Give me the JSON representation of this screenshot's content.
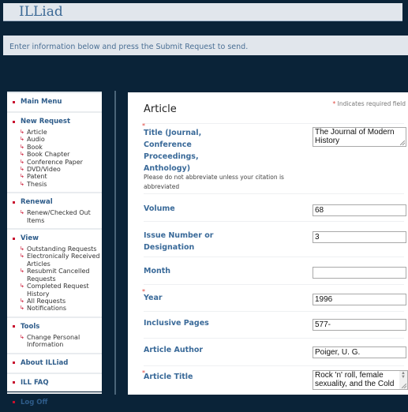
{
  "app": {
    "title": "ILLiad"
  },
  "notice": "Enter information below and press the Submit Request to send.",
  "sidebar": {
    "sections": [
      {
        "label": "Main Menu",
        "items": []
      },
      {
        "label": "New Request",
        "items": [
          "Article",
          "Audio",
          "Book",
          "Book Chapter",
          "Conference Paper",
          "DVD/Video",
          "Patent",
          "Thesis"
        ]
      },
      {
        "label": "Renewal",
        "items": [
          "Renew/Checked Out Items"
        ]
      },
      {
        "label": "View",
        "items": [
          "Outstanding Requests",
          "Electronically Received Articles",
          "Resubmit Cancelled Requests",
          "Completed Request History",
          "All Requests",
          "Notifications"
        ]
      },
      {
        "label": "Tools",
        "items": [
          "Change Personal Information"
        ]
      },
      {
        "label": "About ILLiad",
        "items": []
      },
      {
        "label": "ILL FAQ",
        "items": []
      },
      {
        "label": "Log Off",
        "items": []
      }
    ],
    "bullet_color": "#c8102e"
  },
  "form": {
    "heading": "Article",
    "required_note": "Indicates required field",
    "required_marker": "*",
    "fields": [
      {
        "label": "Title (Journal, Conference Proceedings, Anthology)",
        "required": true,
        "hint": "Please do not abbreviate unless your citation is abbreviated",
        "value": "The Journal of Modern History",
        "type": "textarea"
      },
      {
        "label": "Volume",
        "required": false,
        "value": "68",
        "type": "text"
      },
      {
        "label": "Issue Number or Designation",
        "required": false,
        "value": "3",
        "type": "text"
      },
      {
        "label": "Month",
        "required": false,
        "value": "",
        "type": "text"
      },
      {
        "label": "Year",
        "required": true,
        "value": "1996",
        "type": "text"
      },
      {
        "label": "Inclusive Pages",
        "required": false,
        "value": "577-",
        "type": "text"
      },
      {
        "label": "Article Author",
        "required": false,
        "value": "Poiger, U. G.",
        "type": "text"
      },
      {
        "label": "Article Title",
        "required": true,
        "value": "Rock 'n' roll, female sexuality, and the Cold",
        "type": "textarea"
      }
    ]
  },
  "colors": {
    "background": "#0a2338",
    "link": "#2e5c8a",
    "label": "#3a6a99",
    "required": "#e0453d"
  }
}
